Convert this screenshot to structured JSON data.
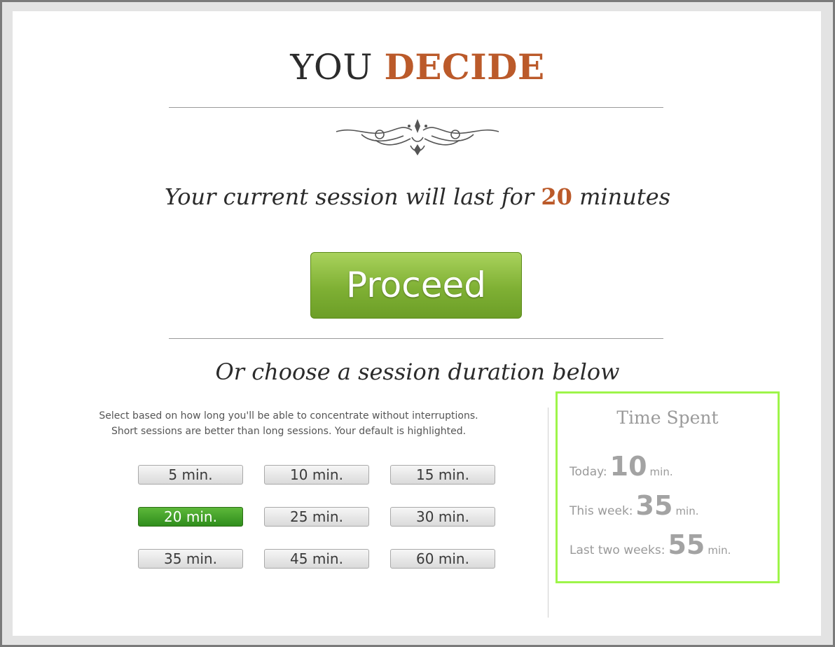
{
  "header": {
    "title_plain": "YOU",
    "title_accent": "DECIDE",
    "accent_color": "#bb5a2a"
  },
  "session": {
    "prefix": "Your current session will last for",
    "minutes": "20",
    "suffix": "minutes"
  },
  "proceed_label": "Proceed",
  "choose_heading": "Or choose a session duration below",
  "hint": {
    "line1": "Select based on how long you'll be able to concentrate without interruptions.",
    "line2": "Short sessions are better than long sessions. Your default is highlighted."
  },
  "durations": [
    {
      "label": "5 min."
    },
    {
      "label": "10 min."
    },
    {
      "label": "15 min."
    },
    {
      "label": "20 min.",
      "selected": true
    },
    {
      "label": "25 min."
    },
    {
      "label": "30 min."
    },
    {
      "label": "35 min."
    },
    {
      "label": "45 min."
    },
    {
      "label": "60 min."
    }
  ],
  "time_spent": {
    "title": "Time Spent",
    "rows": [
      {
        "label": "Today:",
        "value": "10",
        "unit": "min."
      },
      {
        "label": "This week:",
        "value": "35",
        "unit": "min."
      },
      {
        "label": "Last two weeks:",
        "value": "55",
        "unit": "min."
      }
    ],
    "border_color": "#9ef54a"
  },
  "colors": {
    "proceed_green": "#7fb034",
    "selected_green": "#2f8d1c"
  }
}
